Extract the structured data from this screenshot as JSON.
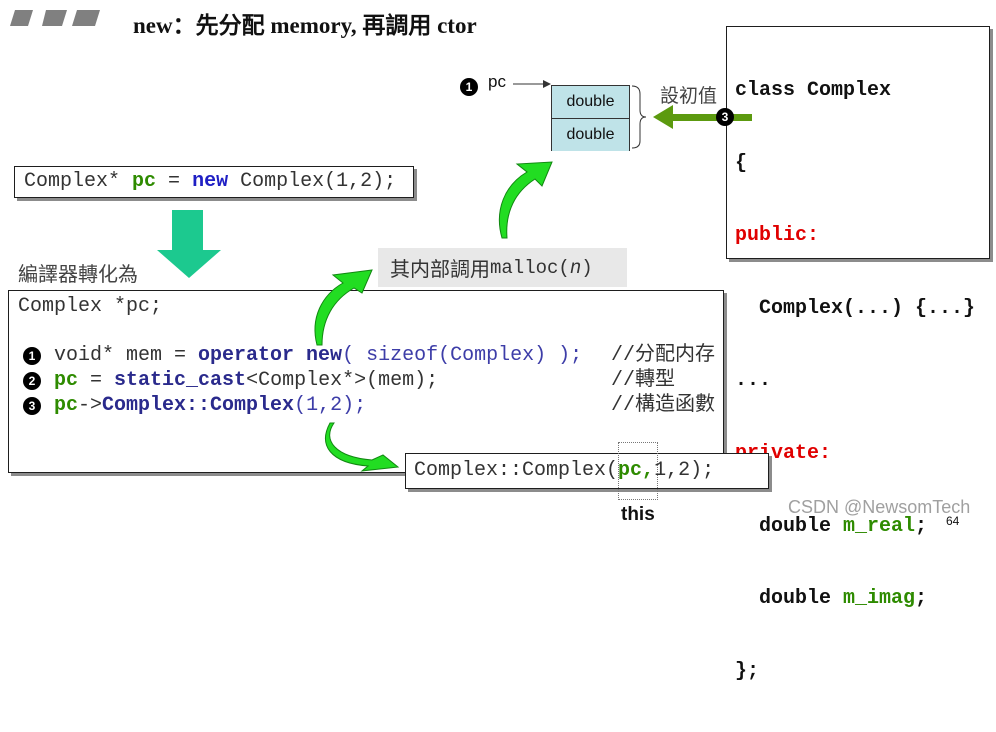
{
  "slide": {
    "title": "new：先分配 memory, 再調用 ctor",
    "page_number": "64",
    "watermark": "CSDN @NewsomTech"
  },
  "source_snippet": {
    "segments": [
      {
        "text": "Complex* ",
        "style": "plain"
      },
      {
        "text": "pc",
        "style": "variable"
      },
      {
        "text": " = ",
        "style": "plain"
      },
      {
        "text": "new",
        "style": "new_keyword"
      },
      {
        "text": " Complex(1,2);",
        "style": "plain"
      }
    ]
  },
  "compiler_label": "編譯器轉化為",
  "malloc_note": {
    "prefix": "其内部調用 ",
    "code": "malloc(",
    "arg": "n",
    "suffix": ")"
  },
  "expanded_code": {
    "declaration": "Complex *pc;",
    "lines": [
      {
        "step": "1",
        "segments": [
          {
            "text": "void* mem = ",
            "style": "plain"
          },
          {
            "text": "operator new",
            "style": "keyword"
          },
          {
            "text": "( sizeof(Complex) );",
            "style": "argument"
          }
        ],
        "comment": "//分配内存"
      },
      {
        "step": "2",
        "segments": [
          {
            "text": "pc",
            "style": "variable"
          },
          {
            "text": " = ",
            "style": "plain"
          },
          {
            "text": "static_cast",
            "style": "keyword"
          },
          {
            "text": "<Complex*>(mem);",
            "style": "plain"
          }
        ],
        "comment": "//轉型"
      },
      {
        "step": "3",
        "segments": [
          {
            "text": "pc",
            "style": "variable"
          },
          {
            "text": "->",
            "style": "plain"
          },
          {
            "text": "Complex::Complex",
            "style": "keyword"
          },
          {
            "text": "(1,2);",
            "style": "argument"
          }
        ],
        "comment": "//構造函數"
      }
    ]
  },
  "ctor_call": {
    "segments": [
      {
        "text": "Complex::Complex(",
        "style": "plain"
      },
      {
        "text": "pc,",
        "style": "variable"
      },
      {
        "text": "1,2);",
        "style": "plain"
      }
    ],
    "this_label": "this"
  },
  "memory_diagram": {
    "pointer_step": "1",
    "pointer_label": "pc",
    "cells": [
      "double",
      "double"
    ],
    "init_label": "設初值",
    "init_step": "3"
  },
  "class_def": {
    "lines": [
      [
        {
          "text": "class Complex",
          "style": "bold"
        }
      ],
      [
        {
          "text": "{",
          "style": "bold"
        }
      ],
      [
        {
          "text": "public:",
          "style": "access"
        }
      ],
      [
        {
          "text": "  Complex(...) {...}",
          "style": "bold"
        }
      ],
      [
        {
          "text": "...",
          "style": "bold"
        }
      ],
      [
        {
          "text": "private:",
          "style": "access"
        }
      ],
      [
        {
          "text": "  double ",
          "style": "bold"
        },
        {
          "text": "m_real",
          "style": "member"
        },
        {
          "text": ";",
          "style": "bold"
        }
      ],
      [
        {
          "text": "  double ",
          "style": "bold"
        },
        {
          "text": "m_imag",
          "style": "member"
        },
        {
          "text": ";",
          "style": "bold"
        }
      ],
      [
        {
          "text": "};",
          "style": "bold"
        }
      ]
    ]
  },
  "colors": {
    "keyword": "#2a2a8c",
    "argument": "#3d3da8",
    "variable": "#2e8b00",
    "new_keyword": "#1f1fc4",
    "access_specifier": "#e00000",
    "member": "#2e8b00",
    "plain_code": "#333333",
    "comment": "#333333",
    "memory_cell": "#bfe3e8",
    "note_bg": "#e8e8e8",
    "curved_arrow": "#22dd22",
    "curved_arrow_edge": "#118811",
    "down_arrow": "#1cc98f",
    "init_arrow": "#5c9a0f",
    "title_bars": "#808080",
    "watermark": "#a0a0a0"
  }
}
